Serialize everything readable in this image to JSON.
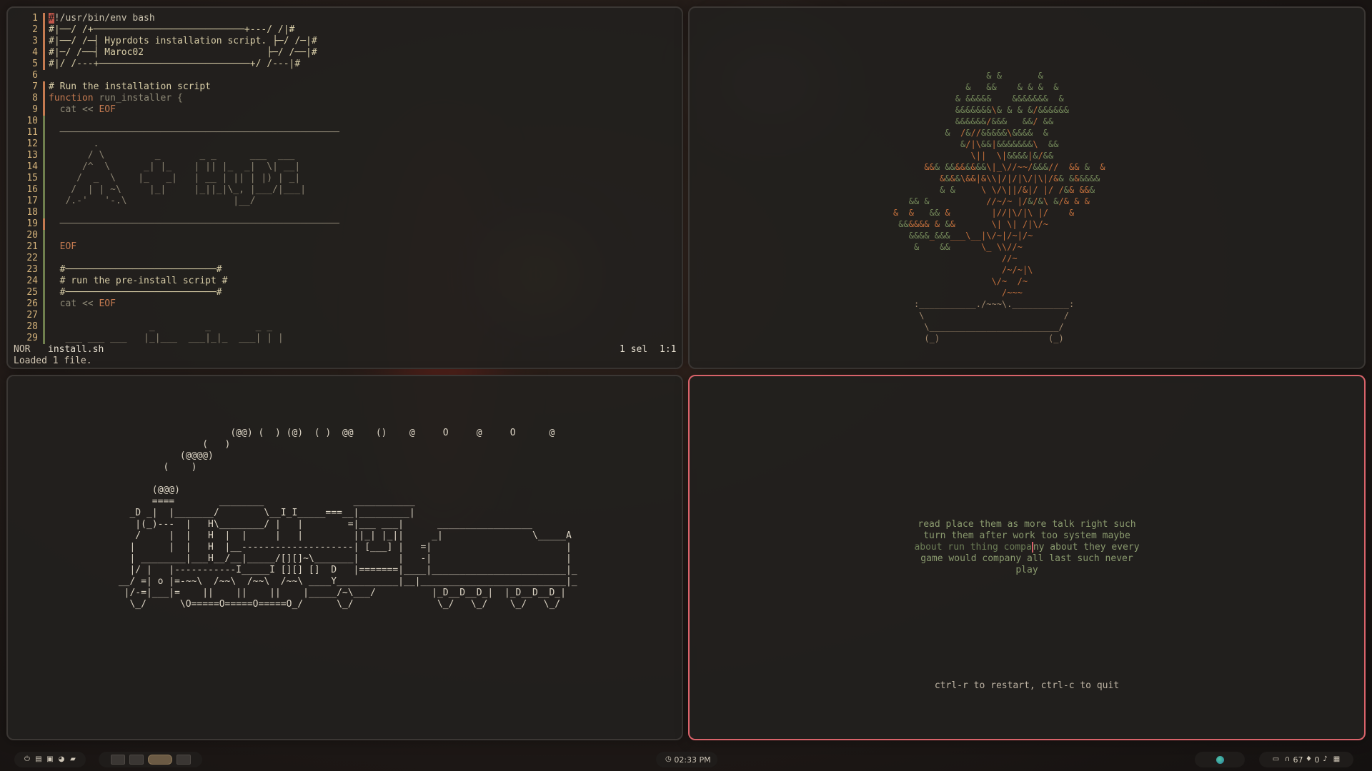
{
  "editor": {
    "lines": [
      "#!/usr/bin/env bash",
      "#|──/ /+───────────────────────────+---/ /|#",
      "#|──/ /─┤ Hyprdots installation script. ├─/ /─|#",
      "#|─/ /──┤ Maroc02                      ├─/ /──|#",
      "#|/ /---+───────────────────────────+/ /---|#",
      "",
      "# Run the installation script",
      "function run_installer {",
      "  cat << EOF",
      "",
      "  ──────────────────────────────────────────────────",
      "        .",
      "       / \\         _       _ _      ___  ___",
      "      /^  \\      _| |_    | || |_  _|  \\| __|",
      "     /  _  \\    |_   _|   | __ | || | |) | _|",
      "    /  | | ~\\     |_|     |_||_|\\_, |___/|___|",
      "   /.-'   '-.\\                   |__/",
      "",
      "  ──────────────────────────────────────────────────",
      "",
      "  EOF",
      "",
      "  #───────────────────────────#",
      "  # run the pre-install script #",
      "  #───────────────────────────#",
      "  cat << EOF",
      "",
      "                  _         _        _ _",
      "   ___ ___ ___   |_|___  ___|_|_  ___| | |"
    ],
    "status": {
      "mode": "NOR",
      "file": "install.sh",
      "selection": "1 sel",
      "cursor": "1:1"
    },
    "message": "Loaded 1 file."
  },
  "bonsai": {
    "lines": [
      "                  & &       &",
      "              &   &&    & & &  &",
      "            & &&&&&    &&&&&&&  &",
      "            &&&&&&&\\& & & &/&&&&&&",
      "            &&&&&&/&&&   &&/ &&",
      "          &  /&//&&&&&\\&&&&  &",
      "             &/|\\&&|&&&&&&&\\  &&",
      "               \\||  \\|&&&&|&/&&",
      "      &&& &&&&&&&&\\|_\\//~~/&&&//  && &  &",
      "         &&&&\\&&|&\\\\|/|/|\\/|\\|/&& &&&&&&",
      "         & &     \\ \\/\\||/&|/ |/ /&& &&&",
      "   && &           //~/~ |/&/&\\ &/& & &",
      "&  &   && &        |//|\\/|\\ |/    &",
      " &&&&&& & &&       \\| \\| /|\\/~",
      "   &&&&_&&&___\\__|\\/~|/~|/~",
      "    &    &&      \\_ \\\\//~",
      "                     //~",
      "                     /~/~|\\",
      "                   \\/~  /~",
      "                     /~~~",
      "    :___________./~~~\\.___________:",
      "     \\                           /",
      "      \\_________________________/",
      "      (_)                     (_)"
    ]
  },
  "train": {
    "lines": [
      "                     (@@) (  ) (@)  ( )  @@    ()    @     O     @     O      @",
      "                (   )",
      "            (@@@@)",
      "         (    )",
      "",
      "       (@@@)",
      "       ====        ________                ___________",
      "   _D _|  |_______/        \\__I_I_____===__|_________|",
      "    |(_)---  |   H\\________/ |   |        =|___ ___|      _________________",
      "    /     |  |   H  |  |     |   |         ||_| |_||     _|                \\_____A",
      "   |      |  |   H  |__--------------------| [___] |   =|                        |",
      "   | ________|___H__/__|_____/[][]~\\_______|       |   -|                        |",
      "   |/ |   |-----------I_____I [][] []  D   |=======|____|________________________|_",
      " __/ =| o |=-~~\\  /~~\\  /~~\\  /~~\\ ____Y___________|__|__________________________|_",
      "  |/-=|___|=    ||    ||    ||    |_____/~\\___/          |_D__D__D_|  |_D__D__D_|",
      "   \\_/      \\O=====O=====O=====O_/      \\_/               \\_/   \\_/    \\_/   \\_/"
    ]
  },
  "typing": {
    "lines": [
      {
        "typed": "",
        "rest": "read place them as more talk right such"
      },
      {
        "typed": "",
        "rest": "turn them after work too system maybe"
      },
      {
        "typed": "about run thing compa",
        "rest": "ny about they every"
      },
      {
        "typed": "",
        "rest": "game would company all last such never"
      },
      {
        "typed": "",
        "rest": "play"
      }
    ],
    "hint": "ctrl-r to restart, ctrl-c to quit"
  },
  "taskbar": {
    "clock": "02:33 PM",
    "battery": "67",
    "notifications": "0",
    "left_icons": [
      "power-icon",
      "files-icon",
      "screenshot-icon",
      "palette-icon",
      "lock-icon"
    ],
    "workspaces": [
      1,
      2,
      3,
      4
    ],
    "active_workspace": 3
  },
  "colors": {
    "accent_border": "#d9636a",
    "gutter_modified": "#c47a50",
    "gutter_added": "#6f7f4e",
    "bonsai_leaf": "#6b7d52",
    "bonsai_branch": "#c4703c"
  }
}
